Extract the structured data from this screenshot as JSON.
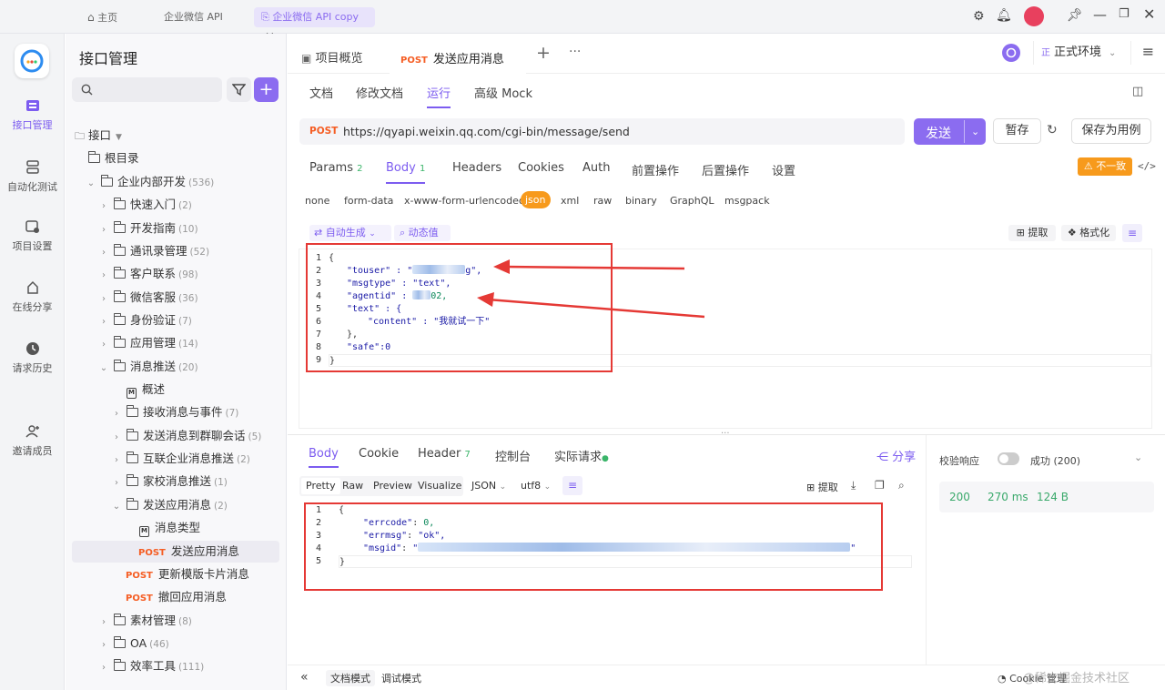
{
  "titlebar": {
    "home": "主页",
    "tab1": "企业微信 API",
    "tab2": "企业微信 API copy",
    "close": "×"
  },
  "rail": {
    "items": [
      {
        "label": "接口管理"
      },
      {
        "label": "自动化测试"
      },
      {
        "label": "项目设置"
      },
      {
        "label": "在线分享"
      },
      {
        "label": "请求历史"
      },
      {
        "label": "邀请成员"
      }
    ],
    "accent": "#7c5cf0"
  },
  "sidebar": {
    "title": "接口管理",
    "plus": "+",
    "interface_label": "接口",
    "root": "根目录",
    "tree": [
      {
        "label": "企业内部开发",
        "count": "(536)",
        "open": true
      },
      {
        "label": "快速入门",
        "count": "(2)"
      },
      {
        "label": "开发指南",
        "count": "(10)"
      },
      {
        "label": "通讯录管理",
        "count": "(52)"
      },
      {
        "label": "客户联系",
        "count": "(98)"
      },
      {
        "label": "微信客服",
        "count": "(36)"
      },
      {
        "label": "身份验证",
        "count": "(7)"
      },
      {
        "label": "应用管理",
        "count": "(14)"
      },
      {
        "label": "消息推送",
        "count": "(20)",
        "open": true
      },
      {
        "label": "概述",
        "count": ""
      },
      {
        "label": "接收消息与事件",
        "count": "(7)"
      },
      {
        "label": "发送消息到群聊会话",
        "count": "(5)"
      },
      {
        "label": "互联企业消息推送",
        "count": "(2)"
      },
      {
        "label": "家校消息推送",
        "count": "(1)"
      },
      {
        "label": "发送应用消息",
        "count": "(2)",
        "open": true
      },
      {
        "label": "消息类型",
        "count": ""
      },
      {
        "label": "发送应用消息",
        "count": "",
        "method": "POST"
      },
      {
        "label": "更新模版卡片消息",
        "count": "",
        "method": "POST"
      },
      {
        "label": "撤回应用消息",
        "count": "",
        "method": "POST"
      },
      {
        "label": "素材管理",
        "count": "(8)"
      },
      {
        "label": "OA",
        "count": "(46)"
      },
      {
        "label": "效率工具",
        "count": "(111)"
      }
    ]
  },
  "main": {
    "tabs": [
      {
        "label": "项目概览"
      },
      {
        "label": "发送应用消息",
        "method": "POST"
      }
    ],
    "plus": "+",
    "more": "···",
    "env": "正式环境",
    "env_badge": "正",
    "subtabs": [
      "文档",
      "修改文档",
      "运行",
      "高级 Mock"
    ],
    "method": "POST",
    "url": "https://qyapi.weixin.qq.com/cgi-bin/message/send",
    "send": "发送",
    "save": "暂存",
    "save_case": "保存为用例",
    "req_tabs": [
      {
        "label": "Params",
        "count": "2"
      },
      {
        "label": "Body",
        "count": "1"
      },
      {
        "label": "Headers",
        "count": ""
      },
      {
        "label": "Cookies",
        "count": ""
      },
      {
        "label": "Auth",
        "count": ""
      },
      {
        "label": "前置操作",
        "count": ""
      },
      {
        "label": "后置操作",
        "count": ""
      },
      {
        "label": "设置",
        "count": ""
      }
    ],
    "inconsistent": "不一致",
    "body_types": [
      "none",
      "form-data",
      "x-www-form-urlencoded",
      "json",
      "xml",
      "raw",
      "binary",
      "GraphQL",
      "msgpack"
    ],
    "auto_gen": "自动生成",
    "dynamic": "动态值",
    "extract": "提取",
    "format": "格式化",
    "request_code": {
      "lines": [
        "{",
        "\"touser\" : \"",
        "\"msgtype\" : \"text\",",
        "\"agentid\" : ",
        "\"text\" : {",
        "\"content\" : \"我就试一下\"",
        "},",
        "\"safe\":0",
        "}"
      ],
      "touser_tail": "g\",",
      "agentid_tail": "02,"
    },
    "resp_tabs": [
      {
        "label": "Body",
        "count": ""
      },
      {
        "label": "Cookie",
        "count": ""
      },
      {
        "label": "Header",
        "count": "7"
      },
      {
        "label": "控制台",
        "count": ""
      },
      {
        "label": "实际请求",
        "count": ""
      }
    ],
    "share": "分享",
    "view_modes": [
      "Pretty",
      "Raw",
      "Preview",
      "Visualize"
    ],
    "lang": "JSON",
    "encoding": "utf8",
    "resp_extract": "提取",
    "response_code": {
      "l1": "{",
      "errcode_key": "\"errcode\"",
      "errcode_val": "0,",
      "errmsg_key": "\"errmsg\"",
      "errmsg_val": "\"ok\",",
      "msgid_key": "\"msgid\"",
      "msgid_head": "\"",
      "msgid_tail": "\"",
      "l5": "}"
    },
    "validate": "校验响应",
    "success": "成功 (200)",
    "status": "200",
    "time": "270 ms",
    "size": "124 B",
    "bottom": {
      "doc_mode": "文档模式",
      "debug_mode": "调试模式",
      "cookie": "Cookie 管理",
      "watermark": "@稀土掘金技术社区"
    }
  }
}
